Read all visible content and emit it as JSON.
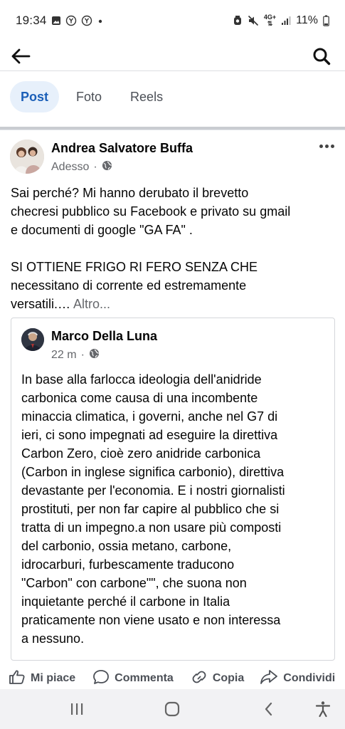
{
  "status_bar": {
    "time": "19:34",
    "network_top": "4G+",
    "battery": "11%",
    "icons": [
      "gallery-icon",
      "circle-y-icon",
      "circle-y-icon",
      "dot-icon",
      "alarm-icon",
      "mute-icon",
      "signal-icon",
      "battery-icon"
    ]
  },
  "appbar": {
    "icons": [
      "back-arrow-icon",
      "search-icon"
    ]
  },
  "tabs": [
    {
      "label": "Post",
      "active": true
    },
    {
      "label": "Foto",
      "active": false
    },
    {
      "label": "Reels",
      "active": false
    }
  ],
  "post": {
    "author": "Andrea Salvatore Buffa",
    "time": "Adesso",
    "separator": "·",
    "audience_icon": "globe-icon",
    "text_p1_lines": [
      "Sai perché? Mi hanno derubato il brevetto",
      "checresi pubblico su Facebook e privato su gmail",
      "e documenti di google \"GA FA\" ."
    ],
    "text_p2_lines": [
      "SI OTTIENE FRIGO RI FERO SENZA CHE",
      "necessitano di corrente ed estremamente"
    ],
    "text_p2_last": "versatili.…",
    "more_label": "Altro..."
  },
  "shared": {
    "author": "Marco Della Luna",
    "time": "22 m",
    "separator": "·",
    "audience_icon": "globe-icon",
    "lines": [
      "In base alla farlocca ideologia dell'anidride",
      "carbonica come causa di una incombente",
      "minaccia climatica, i governi, anche nel G7 di",
      "ieri, ci sono impegnati ad eseguire la direttiva",
      "Carbon Zero, cioè zero anidride carbonica",
      "(Carbon in inglese significa carbonio), direttiva",
      "devastante per l'economia. E i nostri giornalisti",
      "prostituti, per non far capire al pubblico che si",
      "tratta di un impegno.a non usare più composti",
      "del carbonio, ossia metano, carbone,",
      "idrocarburi, furbescamente traducono",
      "\"Carbon\" con carbone\"\", che suona non",
      "inquietante perché il carbone in Italia",
      "praticamente non viene usato e non interessa",
      "a nessuno."
    ]
  },
  "actions": {
    "like": "Mi piace",
    "comment": "Commenta",
    "copy": "Copia",
    "share": "Condividi"
  },
  "navbar": {
    "icons": [
      "recent-apps-icon",
      "home-icon",
      "back-icon",
      "accessibility-icon"
    ]
  }
}
